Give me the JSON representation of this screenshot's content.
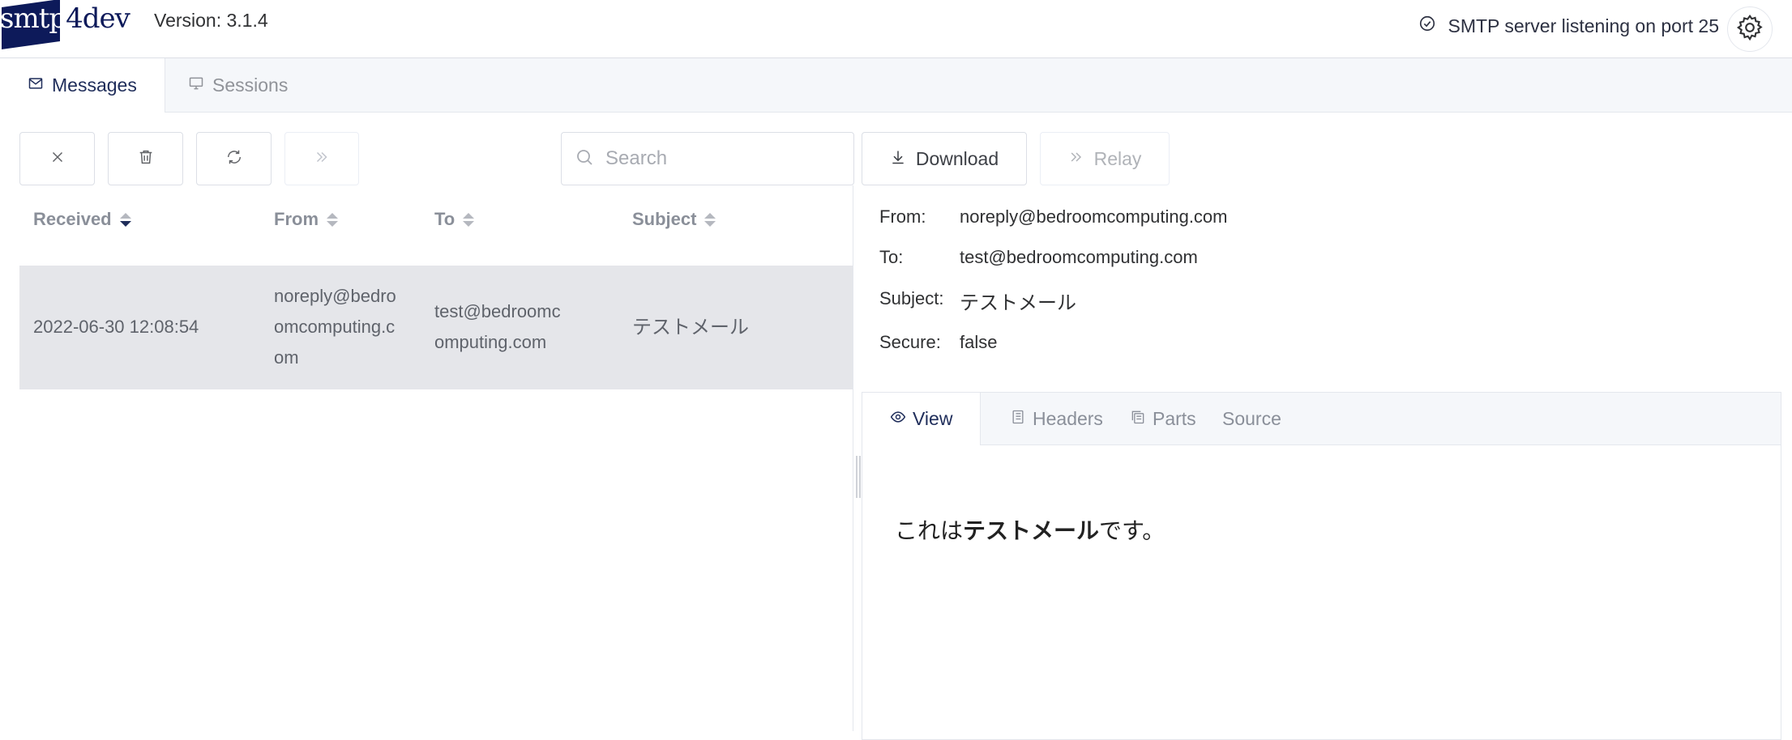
{
  "header": {
    "logo_text_dark": "smtp",
    "logo_text_light": "4dev",
    "version": "Version: 3.1.4",
    "status": "SMTP server listening on port 25"
  },
  "main_tabs": [
    {
      "label": "Messages",
      "icon": "envelope-icon",
      "active": true
    },
    {
      "label": "Sessions",
      "icon": "monitor-icon",
      "active": false
    }
  ],
  "toolbar": {
    "search_placeholder": "Search",
    "download_label": "Download",
    "relay_label": "Relay"
  },
  "table": {
    "columns": [
      "Received",
      "From",
      "To",
      "Subject"
    ],
    "rows": [
      {
        "received": "2022-06-30 12:08:54",
        "from_lines": [
          "noreply@bedro",
          "omcomputing.c",
          "om"
        ],
        "to_lines": [
          "test@bedroomc",
          "omputing.com"
        ],
        "subject": "テストメール"
      }
    ]
  },
  "details": {
    "from_label": "From:",
    "from_value": "noreply@bedroomcomputing.com",
    "to_label": "To:",
    "to_value": "test@bedroomcomputing.com",
    "subject_label": "Subject:",
    "subject_value": "テストメール",
    "secure_label": "Secure:",
    "secure_value": "false"
  },
  "detail_tabs": [
    {
      "label": "View",
      "icon": "eye-icon",
      "active": true
    },
    {
      "label": "Headers",
      "icon": "document-icon",
      "active": false
    },
    {
      "label": "Parts",
      "icon": "copy-icon",
      "active": false
    },
    {
      "label": "Source",
      "icon": "",
      "active": false
    }
  ],
  "message_body": {
    "prefix": "これは",
    "bold": "テストメール",
    "suffix": "です。"
  },
  "colors": {
    "accent": "#1f2d5a",
    "row_selected": "#e5e6ea",
    "tab_bar": "#f5f7fa"
  }
}
